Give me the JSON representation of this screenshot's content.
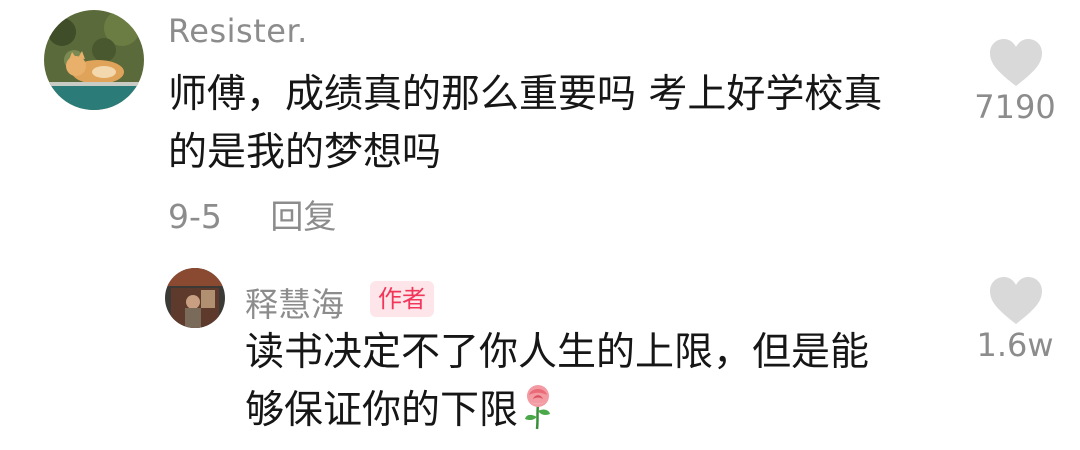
{
  "comment": {
    "username": "Resister.",
    "text_line1": "师傅，成绩真的那么重要吗 考上好学校真",
    "text_line2": "的是我的梦想吗",
    "date": "9-5",
    "reply_label": "回复",
    "like_count": "7190",
    "like_icon": "heart-icon",
    "avatar_icon": "cat-avatar"
  },
  "reply": {
    "username": "释慧海",
    "badge": "作者",
    "text_line1": "读书决定不了你人生的上限，但是能",
    "text_line2": "够保证你的下限",
    "emoji_icon": "rose-icon",
    "like_count": "1.6w",
    "like_icon": "heart-icon",
    "avatar_icon": "monk-avatar"
  },
  "colors": {
    "text_primary": "#161616",
    "text_secondary": "#8c8c8c",
    "heart_gray": "#d9d9d9",
    "badge_bg": "#fde5ea",
    "badge_text": "#f2365a"
  }
}
